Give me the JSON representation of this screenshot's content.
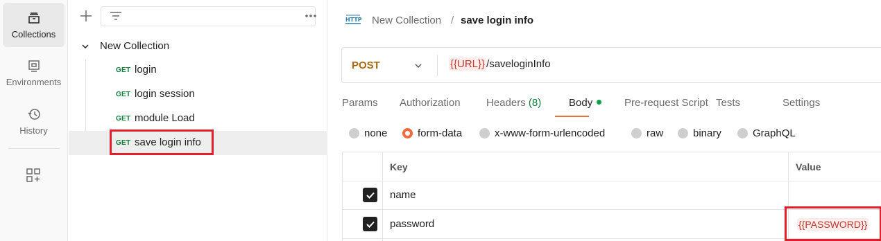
{
  "sidebar": {
    "items": [
      {
        "label": "Collections",
        "icon": "collections-icon",
        "active": true
      },
      {
        "label": "Environments",
        "icon": "environments-icon",
        "active": false
      },
      {
        "label": "History",
        "icon": "history-icon",
        "active": false
      }
    ],
    "extra_icon": "add-widget-icon"
  },
  "collections_panel": {
    "collection_name": "New Collection",
    "requests": [
      {
        "method": "GET",
        "name": "login"
      },
      {
        "method": "GET",
        "name": "login session"
      },
      {
        "method": "GET",
        "name": "module Load"
      },
      {
        "method": "GET",
        "name": "save login info",
        "selected": true
      }
    ]
  },
  "breadcrumb": {
    "collection": "New Collection",
    "separator": "/",
    "request": "save login info"
  },
  "request": {
    "method": "POST",
    "url_variable": "{{URL}}",
    "url_path": "/saveloginInfo"
  },
  "tabs": [
    {
      "label": "Params"
    },
    {
      "label": "Authorization"
    },
    {
      "label": "Headers",
      "count": "(8)"
    },
    {
      "label": "Body",
      "active": true,
      "has_dot": true
    },
    {
      "label": "Pre-request Script"
    },
    {
      "label": "Tests"
    },
    {
      "label": "Settings"
    }
  ],
  "body_types": [
    {
      "label": "none",
      "selected": false
    },
    {
      "label": "form-data",
      "selected": true
    },
    {
      "label": "x-www-form-urlencoded",
      "selected": false
    },
    {
      "label": "raw",
      "selected": false
    },
    {
      "label": "binary",
      "selected": false
    },
    {
      "label": "GraphQL",
      "selected": false
    }
  ],
  "form_table": {
    "headers": {
      "key": "Key",
      "value": "Value"
    },
    "rows": [
      {
        "checked": true,
        "key": "name",
        "value": ""
      },
      {
        "checked": true,
        "key": "password",
        "value": "{{PASSWORD}}"
      }
    ]
  },
  "colors": {
    "accent": "#f06c3e",
    "get_method": "#0e7f3a",
    "post_method": "#a86a0d",
    "highlight": "#e3202a",
    "variable": "#c0392b"
  }
}
